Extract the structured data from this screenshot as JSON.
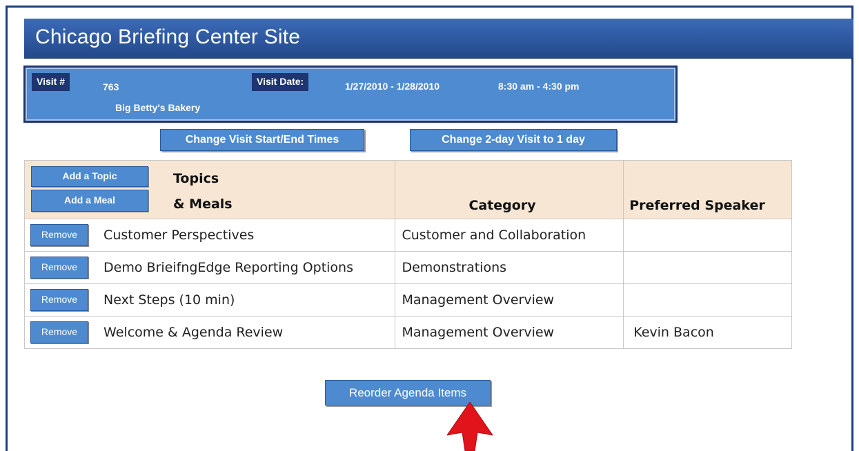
{
  "header": {
    "title": "Chicago Briefing Center Site"
  },
  "visit": {
    "visit_label": "Visit #",
    "visit_number": "763",
    "company": "Big Betty's Bakery",
    "date_label": "Visit Date:",
    "dates": "1/27/2010 - 1/28/2010",
    "times": "8:30 am - 4:30 pm"
  },
  "actions": {
    "change_times": "Change Visit Start/End Times",
    "change_days": "Change 2-day Visit to 1 day",
    "reorder": "Reorder Agenda Items"
  },
  "agenda": {
    "add_topic": "Add a Topic",
    "add_meal": "Add a Meal",
    "header_topics_line1": "Topics",
    "header_topics_line2": "& Meals",
    "header_category": "Category",
    "header_speaker": "Preferred Speaker",
    "remove_label": "Remove",
    "rows": [
      {
        "topic": "Customer Perspectives",
        "category": "Customer and Collaboration",
        "speaker": ""
      },
      {
        "topic": "Demo BrieifngEdge Reporting Options",
        "category": "Demonstrations",
        "speaker": ""
      },
      {
        "topic": "Next Steps (10 min)",
        "category": "Management Overview",
        "speaker": ""
      },
      {
        "topic": "Welcome & Agenda Review",
        "category": "Management Overview",
        "speaker": "Kevin Bacon"
      }
    ]
  },
  "colors": {
    "title_bar": "#2d579f",
    "info_panel": "#4f8bd0",
    "label_badge": "#1d3570",
    "header_row": "#f6e6d3",
    "button": "#4d8ad0",
    "annotation_arrow": "#e0141a"
  },
  "icons": {
    "annotation": "red-arrow-icon"
  }
}
